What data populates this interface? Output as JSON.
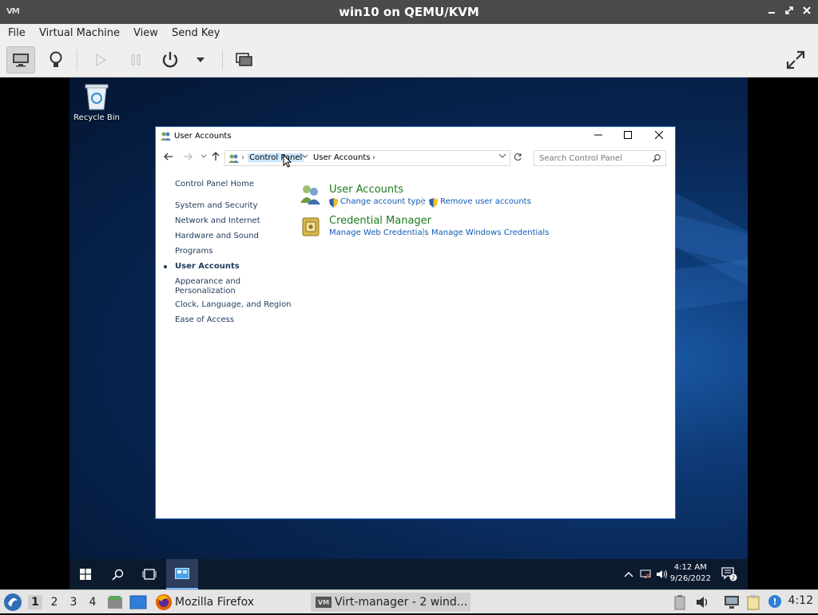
{
  "host_window": {
    "title": "win10 on QEMU/KVM",
    "logo": "VM",
    "controls": [
      "minimize-icon",
      "restore-icon",
      "close-icon"
    ]
  },
  "menubar": {
    "items": [
      {
        "label": "File"
      },
      {
        "label": "Virtual Machine"
      },
      {
        "label": "View"
      },
      {
        "label": "Send Key"
      }
    ]
  },
  "toolbar": {
    "buttons": [
      {
        "icon": "console-icon",
        "active": true
      },
      {
        "icon": "details-lightbulb-icon"
      },
      {
        "icon": "run-icon",
        "disabled": true
      },
      {
        "icon": "pause-icon",
        "disabled": true
      },
      {
        "icon": "power-icon"
      },
      {
        "icon": "chevron-down-icon"
      },
      {
        "icon": "snapshots-icon"
      },
      {
        "icon": "fullscreen-icon"
      }
    ]
  },
  "desktop": {
    "recycle_bin_label": "Recycle Bin"
  },
  "explorer": {
    "title": "User Accounts",
    "breadcrumb": {
      "root_crumb": "Control Panel",
      "current_crumb": "User Accounts"
    },
    "search_placeholder": "Search Control Panel",
    "leftnav": [
      {
        "label": "Control Panel Home"
      },
      {
        "label": "System and Security"
      },
      {
        "label": "Network and Internet"
      },
      {
        "label": "Hardware and Sound"
      },
      {
        "label": "Programs"
      },
      {
        "label": "User Accounts",
        "current": true
      },
      {
        "label": "Appearance and"
      },
      {
        "label": "Personalization"
      },
      {
        "label": "Clock, Language, and Region"
      },
      {
        "label": "Ease of Access"
      }
    ],
    "sections": [
      {
        "heading": "User Accounts",
        "links": [
          "Change account type",
          "Remove user accounts"
        ]
      },
      {
        "heading": "Credential Manager",
        "links": [
          "Manage Web Credentials",
          "Manage Windows Credentials"
        ]
      }
    ]
  },
  "windows_taskbar": {
    "time": "4:12 AM",
    "date": "9/26/2022",
    "notification_count": "2"
  },
  "host_taskbar": {
    "workspaces": [
      "1",
      "2",
      "3",
      "4"
    ],
    "active_workspace": "1",
    "tasks": [
      {
        "label": "Mozilla Firefox"
      },
      {
        "label": "Virt-manager - 2 wind..."
      }
    ],
    "clock": "4:12"
  },
  "colors": {
    "accent_green": "#1e7a1e",
    "link_blue": "#0f5bb5",
    "selected_crumb": "#cce8ff"
  }
}
